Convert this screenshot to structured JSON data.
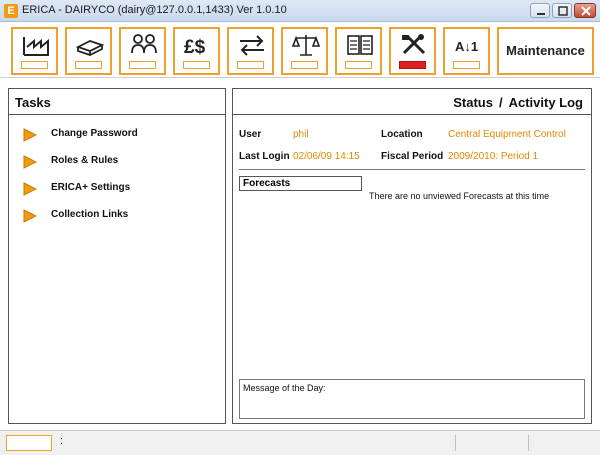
{
  "window": {
    "title": "ERICA - DAIRYCO (dairy@127.0.0.1,1433) Ver 1.0.10",
    "app_icon_letter": "E"
  },
  "toolbar": {
    "buttons": [
      {
        "icon": "factory-icon",
        "active": false
      },
      {
        "icon": "cheese-block-icon",
        "active": false
      },
      {
        "icon": "people-icon",
        "active": false
      },
      {
        "icon": "pound-dollar-icon",
        "active": false
      },
      {
        "icon": "transfer-arrows-icon",
        "active": false
      },
      {
        "icon": "balance-scale-icon",
        "active": false
      },
      {
        "icon": "documents-icon",
        "active": false
      },
      {
        "icon": "tools-icon",
        "active": true
      },
      {
        "icon": "sort-az-icon",
        "active": false
      }
    ],
    "maintenance_label": "Maintenance",
    "currency_glyph": "£$",
    "sort_glyph": "A↓1"
  },
  "tasks": {
    "title": "Tasks",
    "items": [
      {
        "label": "Change Password"
      },
      {
        "label": "Roles & Rules"
      },
      {
        "label": "ERICA+ Settings"
      },
      {
        "label": "Collection Links"
      }
    ]
  },
  "status": {
    "title_left": "Status",
    "title_sep": "/",
    "title_right": "Activity Log",
    "user_label": "User",
    "user_value": "phil",
    "location_label": "Location",
    "location_value": "Central Equipment Control",
    "last_login_label": "Last Login",
    "last_login_value": "02/06/09 14:15",
    "fiscal_period_label": "Fiscal Period",
    "fiscal_period_value": "2009/2010:  Period 1",
    "forecasts_label": "Forecasts",
    "forecasts_message": "There are no unviewed Forecasts at this time",
    "motd_label": "Message of the Day:"
  },
  "statusbar": {
    "separator": ":"
  },
  "colors": {
    "accent": "#f0a02c",
    "value_text": "#e08a00",
    "active_indicator": "#e02020"
  }
}
